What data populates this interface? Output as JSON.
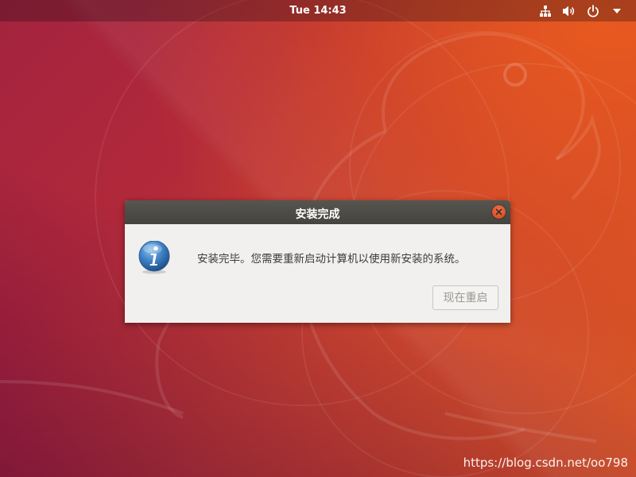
{
  "topbar": {
    "clock": "Tue 14:43",
    "icons": [
      "network-icon",
      "volume-icon",
      "power-icon",
      "chevron-down-icon"
    ]
  },
  "dialog": {
    "title": "安装完成",
    "message": "安装完毕。您需要重新启动计算机以使用新安装的系统。",
    "restart_button": "现在重启",
    "restart_enabled": false,
    "icon": "info-icon"
  },
  "watermark": "https://blog.csdn.net/oo798",
  "colors": {
    "dialog_titlebar": "#4d4b46",
    "close_button": "#e05a2e",
    "info_icon": "#3d7fc1",
    "desktop_orange": "#d95523",
    "desktop_crimson": "#a3233f"
  }
}
